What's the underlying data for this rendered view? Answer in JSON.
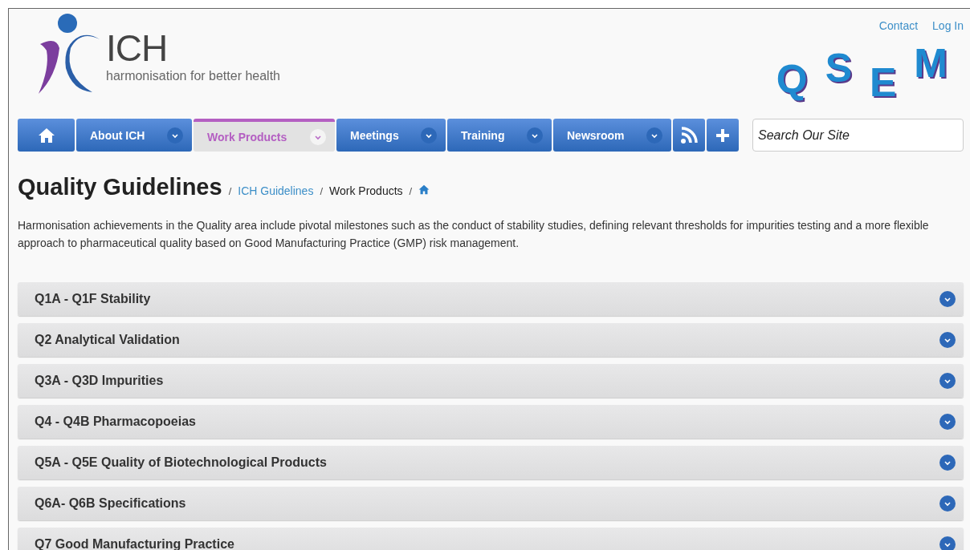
{
  "logo": {
    "name": "ICH",
    "tagline": "harmonisation for better health"
  },
  "top_links": [
    "Contact",
    "Log In"
  ],
  "banner_letters": [
    "Q",
    "S",
    "E",
    "M"
  ],
  "nav": [
    {
      "kind": "home",
      "selected": false
    },
    {
      "kind": "menu",
      "label": "About ICH",
      "selected": false
    },
    {
      "kind": "menu",
      "label": "Work Products",
      "selected": true
    },
    {
      "kind": "menu",
      "label": "Meetings",
      "selected": false
    },
    {
      "kind": "menu",
      "label": "Training",
      "selected": false
    },
    {
      "kind": "menu",
      "label": "Newsroom",
      "selected": false
    },
    {
      "kind": "rss",
      "selected": false
    },
    {
      "kind": "plus",
      "selected": false
    }
  ],
  "search": {
    "placeholder": "Search Our Site"
  },
  "page_title": "Quality Guidelines",
  "breadcrumb_separator": "/",
  "breadcrumb": [
    {
      "label": "ICH Guidelines",
      "link": true
    },
    {
      "label": "Work Products",
      "link": false
    },
    {
      "kind": "home"
    }
  ],
  "intro": "Harmonisation achievements in the Quality area include pivotal milestones such as the conduct of stability studies, defining relevant thresholds for impurities testing and a more flexible approach to pharmaceutical quality based on Good Manufacturing Practice (GMP) risk management.",
  "accordion": [
    {
      "title": "Q1A - Q1F Stability",
      "expanded": false
    },
    {
      "title": "Q2 Analytical Validation",
      "expanded": false
    },
    {
      "title": "Q3A - Q3D Impurities",
      "expanded": false
    },
    {
      "title": "Q4 - Q4B Pharmacopoeias",
      "expanded": false
    },
    {
      "title": "Q5A - Q5E Quality of Biotechnological Products",
      "expanded": false
    },
    {
      "title": "Q6A- Q6B Specifications",
      "expanded": false
    },
    {
      "title": "Q7 Good Manufacturing Practice",
      "expanded": false
    }
  ]
}
